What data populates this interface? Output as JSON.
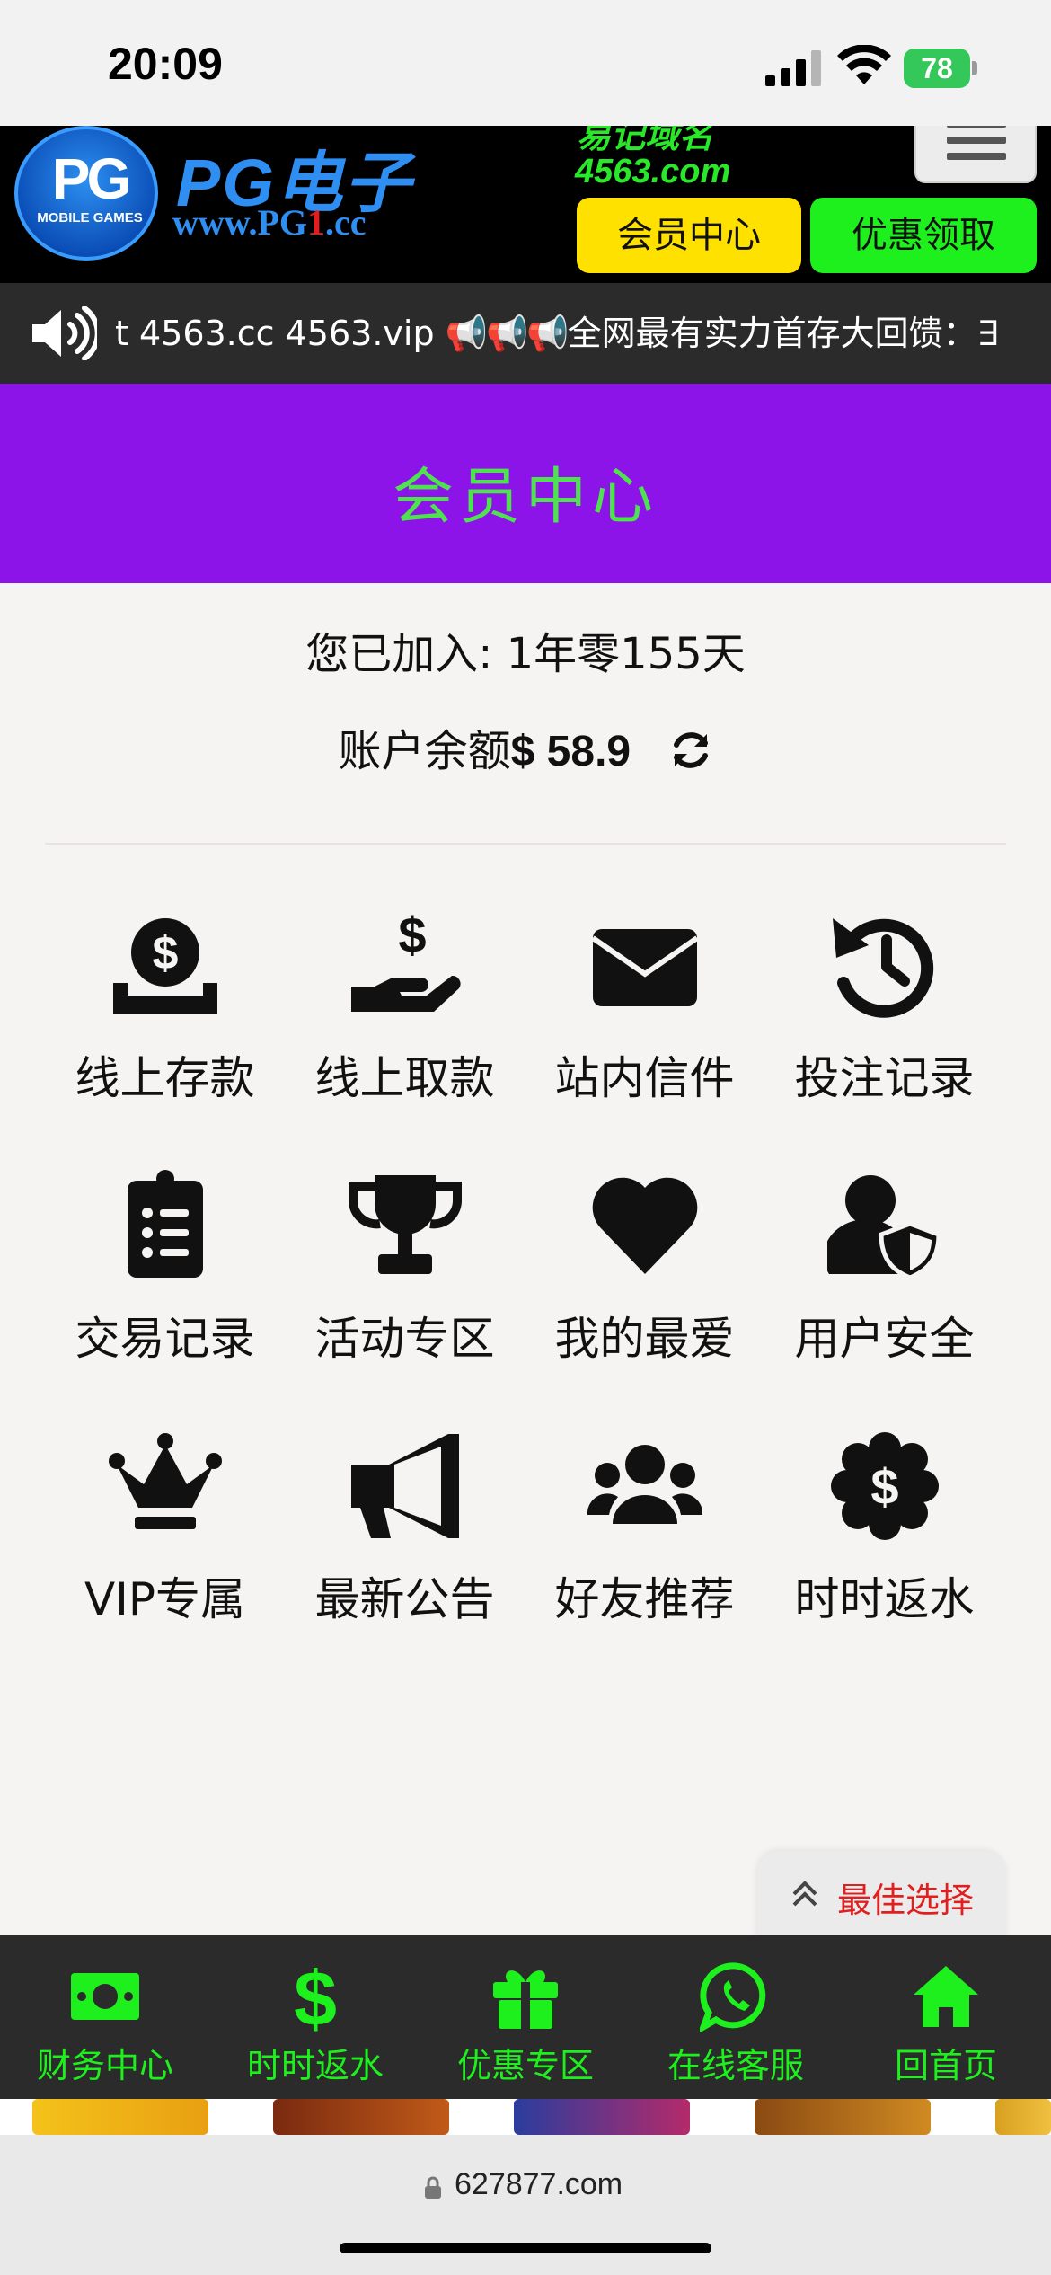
{
  "status_bar": {
    "time": "20:09",
    "battery": "78"
  },
  "header": {
    "logo_pg": "PG",
    "logo_sub": "MOBILE GAMES",
    "logo_title": "PG电子",
    "logo_url_pre": "www.PG",
    "logo_url_red": "1",
    "logo_url_post": ".cc",
    "domain_top": "易记域名",
    "domain_url": "4563.com",
    "member_button": "会员中心",
    "promo_button": "优惠领取"
  },
  "marquee": {
    "text_before": "t 4563.cc 4563.vip  ",
    "horns": "📢📢📢",
    "text_after": "全网最有实力首存大回馈：∃"
  },
  "page_title": "会员中心",
  "account": {
    "joined_label": "您已加入: 1年零155天",
    "balance_label": "账户余额",
    "balance_value": "$ 58.9"
  },
  "grid_items": [
    {
      "label": "线上存款",
      "icon": "deposit-icon"
    },
    {
      "label": "线上取款",
      "icon": "withdraw-icon"
    },
    {
      "label": "站内信件",
      "icon": "envelope-icon"
    },
    {
      "label": "投注记录",
      "icon": "history-icon"
    },
    {
      "label": "交易记录",
      "icon": "clipboard-list-icon"
    },
    {
      "label": "活动专区",
      "icon": "trophy-icon"
    },
    {
      "label": "我的最爱",
      "icon": "heart-icon"
    },
    {
      "label": "用户安全",
      "icon": "user-shield-icon"
    },
    {
      "label": "VIP专属",
      "icon": "crown-icon"
    },
    {
      "label": "最新公告",
      "icon": "megaphone-icon"
    },
    {
      "label": "好友推荐",
      "icon": "users-icon"
    },
    {
      "label": "时时返水",
      "icon": "dollar-badge-icon"
    }
  ],
  "best_pick": "最佳选择",
  "bottom_nav": [
    {
      "label": "财务中心",
      "icon": "money-bill-icon"
    },
    {
      "label": "时时返水",
      "icon": "dollar-icon"
    },
    {
      "label": "优惠专区",
      "icon": "gift-icon"
    },
    {
      "label": "在线客服",
      "icon": "whatsapp-icon"
    },
    {
      "label": "回首页",
      "icon": "home-icon"
    }
  ],
  "browser": {
    "url": "627877.com"
  },
  "colors": {
    "title_bar": "#8c14e8",
    "accent_green": "#1ef01e",
    "member_yellow": "#ffe100",
    "best_pick_red": "#e02020"
  }
}
